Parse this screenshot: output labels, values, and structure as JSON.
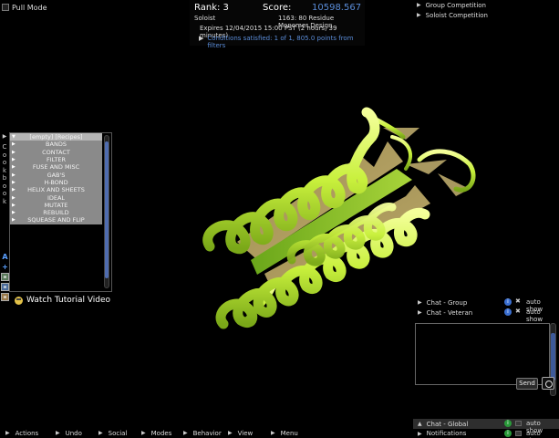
{
  "pull_mode": {
    "label": "Pull Mode"
  },
  "score_panel": {
    "rank": "Rank: 3",
    "score_label": "Score:",
    "score_value": "10598.567",
    "mode": "Soloist",
    "design": "1163: 80 Residue Monomer Design",
    "expires": "Expires 12/04/2015 15:00 PST (2 hours, 39 minutes)",
    "conditions": "Conditions satisfied: 1 of 1, 805.0 points from filters"
  },
  "competitions": [
    {
      "label": "Group Competition"
    },
    {
      "label": "Soloist Competition"
    }
  ],
  "cookbook": {
    "tab_letters": [
      "C",
      "o",
      "o",
      "k",
      "b",
      "o",
      "o",
      "k"
    ],
    "header": "[empty] [Recipes]",
    "items": [
      "BANDS",
      "CONTACT",
      "FILTER",
      "FUSE AND MISC",
      "GAB'S",
      "H-BOND",
      "HELIX AND SHEETS",
      "IDEAL",
      "MUTATE",
      "REBUILD",
      "SQUEASE AND FLIP"
    ]
  },
  "tutorial": {
    "label": "Watch Tutorial Video"
  },
  "chat": {
    "rows": [
      {
        "label": "Chat - Group",
        "auto": "auto show"
      },
      {
        "label": "Chat - Veteran",
        "auto": "auto show"
      }
    ],
    "send_label": "Send",
    "global": {
      "label": "Chat - Global",
      "auto": "auto show"
    },
    "notifications": {
      "label": "Notifications",
      "auto": "auto show"
    }
  },
  "menu": [
    {
      "label": "Actions"
    },
    {
      "label": "Undo"
    },
    {
      "label": "Social"
    },
    {
      "label": "Modes"
    },
    {
      "label": "Behavior"
    },
    {
      "label": "View"
    },
    {
      "label": "Menu"
    }
  ],
  "colors": {
    "score_blue": "#5a8cd8",
    "helix_green": "#c8f03c",
    "sheet_tan": "#a8945a"
  }
}
